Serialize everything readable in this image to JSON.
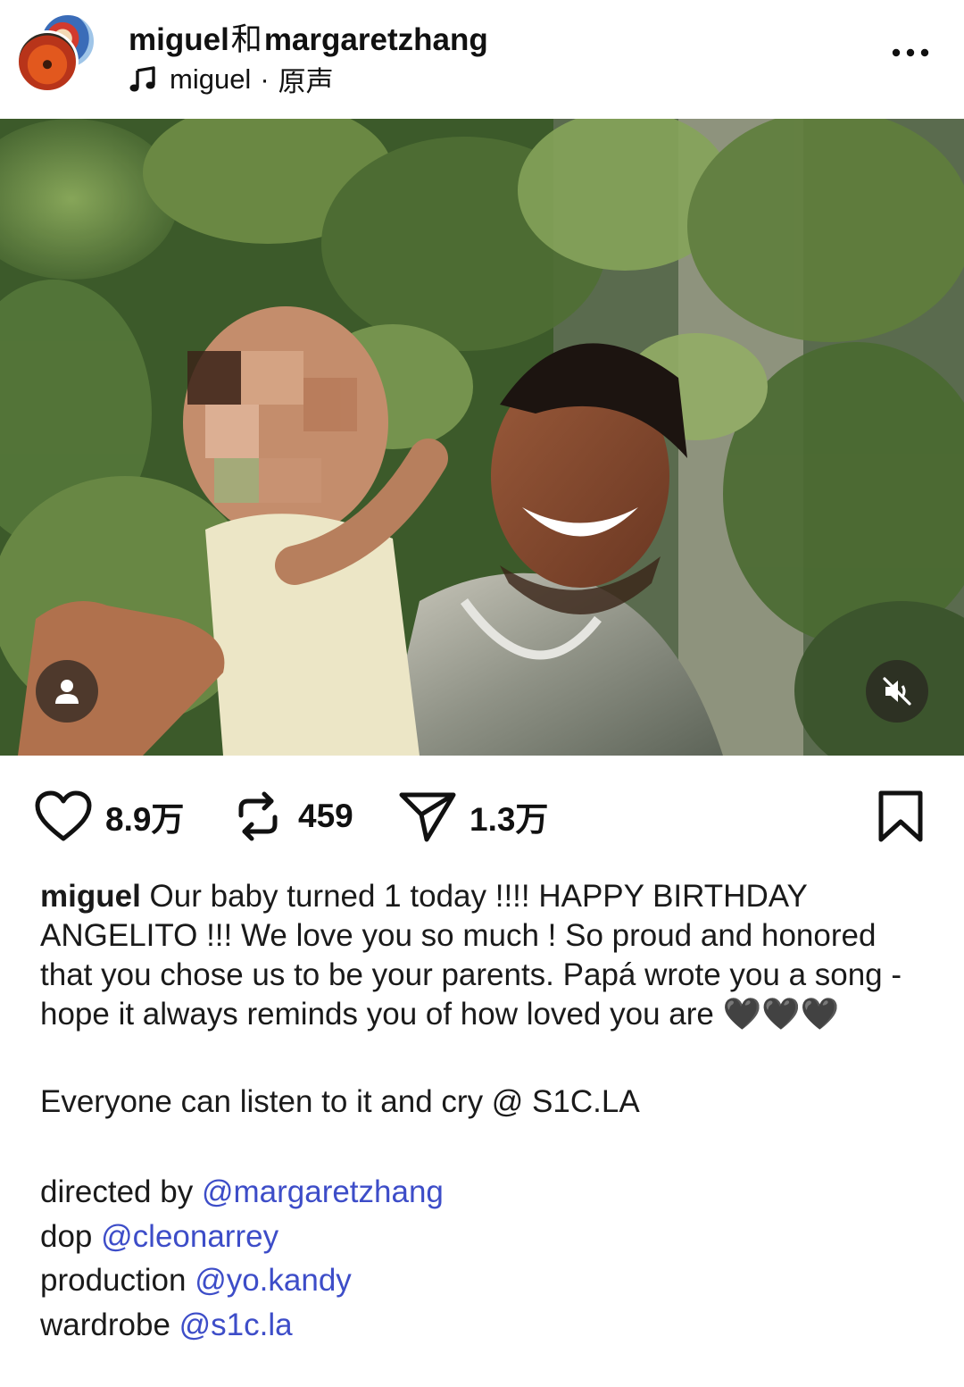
{
  "header": {
    "author_primary": "miguel",
    "author_joiner": "和",
    "author_secondary": "margaretzhang",
    "audio_artist": "miguel",
    "audio_separator": "·",
    "audio_label": "原声",
    "more_icon": "more-horizontal-icon"
  },
  "media": {
    "tags_icon": "person-icon",
    "mute_icon": "speaker-muted-icon"
  },
  "actions": {
    "likes": "8.9万",
    "reposts": "459",
    "shares": "1.3万",
    "icons": [
      "heart-icon",
      "repost-icon",
      "send-icon",
      "bookmark-icon"
    ]
  },
  "caption": {
    "username": "miguel",
    "text": "Our baby turned 1 today !!!! HAPPY BIRTHDAY ANGELITO !!! We love you so much ! So proud and honored that you chose us to be your parents. Papá wrote you a song - hope it always reminds you of how loved you are 🖤🖤🖤",
    "second_paragraph": "Everyone can listen to it and cry @ S1C.LA",
    "credits": [
      {
        "role": "directed by",
        "handle": "@margaretzhang"
      },
      {
        "role": "dop",
        "handle": "@cleonarrey"
      },
      {
        "role": "production",
        "handle": "@yo.kandy"
      },
      {
        "role": "wardrobe",
        "handle": "@s1c.la"
      }
    ]
  },
  "colors": {
    "text": "#111111",
    "mention": "#3d4dc8",
    "background": "#ffffff"
  }
}
